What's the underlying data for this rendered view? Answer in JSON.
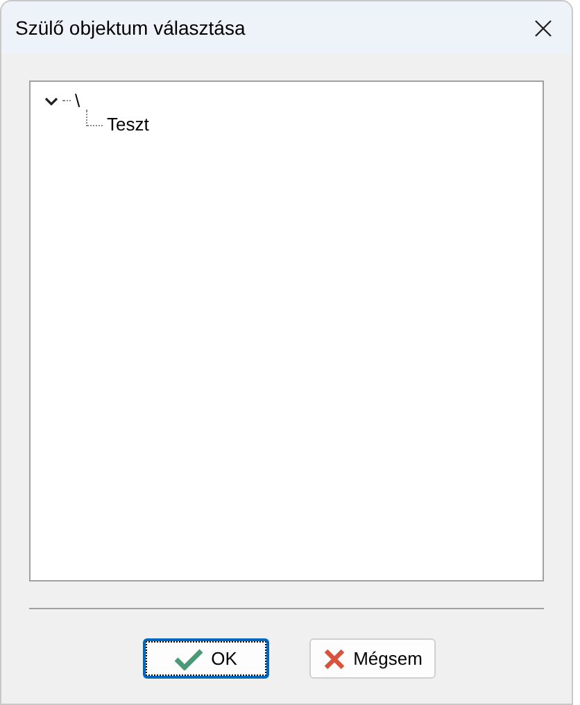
{
  "window": {
    "title": "Szülő objektum választása"
  },
  "tree": [
    {
      "label": "\\",
      "expanded": true,
      "children": [
        {
          "label": "Teszt"
        }
      ]
    }
  ],
  "buttons": [
    {
      "label": "OK",
      "kind": "ok",
      "focused": true
    },
    {
      "label": "Mégsem",
      "kind": "cancel",
      "focused": false
    }
  ]
}
